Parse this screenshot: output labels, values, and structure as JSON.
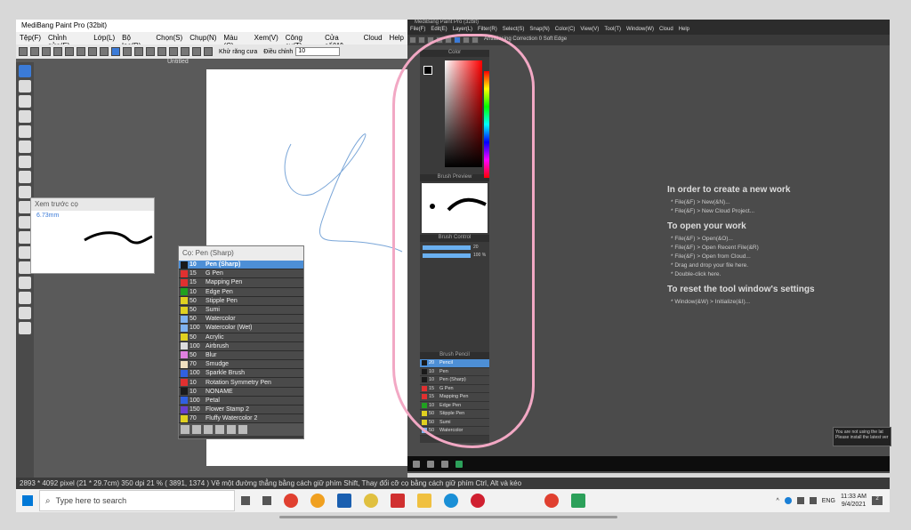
{
  "left_app": {
    "title": "MediBang Paint Pro (32bit)",
    "menu": [
      "Tệp(F)",
      "Chỉnh sửa(E)",
      "Lớp(L)",
      "Bộ lọc(R)",
      "Chọn(S)",
      "Chụp(N)",
      "Màu (C)",
      "Xem(V)",
      "Công cụ(T)",
      "Cửa số(W)",
      "Cloud",
      "Help"
    ],
    "toolbar": {
      "antialias_label": "Khử răng cưa",
      "correction_label": "Điều chỉnh",
      "correction_value": "10"
    },
    "canvas_tab": "Untitled",
    "preview": {
      "title": "Xem trước cọ",
      "size": "6.73mm"
    },
    "brush_window": {
      "title": "Cọ: Pen (Sharp)",
      "items": [
        {
          "size": "10",
          "name": "Pen (Sharp)",
          "color": "#1a1a1a"
        },
        {
          "size": "15",
          "name": "G Pen",
          "color": "#e03030"
        },
        {
          "size": "15",
          "name": "Mapping Pen",
          "color": "#e03030"
        },
        {
          "size": "10",
          "name": "Edge Pen",
          "color": "#20a020"
        },
        {
          "size": "50",
          "name": "Stipple Pen",
          "color": "#e0d020"
        },
        {
          "size": "50",
          "name": "Sumi",
          "color": "#e0d020"
        },
        {
          "size": "50",
          "name": "Watercolor",
          "color": "#7fb2f0"
        },
        {
          "size": "100",
          "name": "Watercolor (Wet)",
          "color": "#7fb2f0"
        },
        {
          "size": "50",
          "name": "Acrylic",
          "color": "#e0d020"
        },
        {
          "size": "100",
          "name": "Airbrush",
          "color": "#dddddd"
        },
        {
          "size": "50",
          "name": "Blur",
          "color": "#e080e0"
        },
        {
          "size": "70",
          "name": "Smudge",
          "color": "#f0e0c0"
        },
        {
          "size": "100",
          "name": "Sparkle Brush",
          "color": "#3060e0"
        },
        {
          "size": "10",
          "name": "Rotation Symmetry Pen",
          "color": "#e03030"
        },
        {
          "size": "10",
          "name": "NONAME",
          "color": "#1a1a1a"
        },
        {
          "size": "100",
          "name": "Petal",
          "color": "#3060e0"
        },
        {
          "size": "150",
          "name": "Flower Stamp 2",
          "color": "#6a3fd0"
        },
        {
          "size": "70",
          "name": "Fluffy Watercolor 2",
          "color": "#e0d020"
        }
      ]
    },
    "status": "2893 * 4092 pixel  (21 * 29.7cm)  350 dpi  21 %  ( 3891, 1374 )  Vẽ một đường thẳng bằng cách giữ phím Shift, Thay đổi cỡ cọ bằng cách giữ phím Ctrl, Alt và kéo"
  },
  "right_app": {
    "title": "MediBang Paint Pro (32bit)",
    "menu": [
      "File(F)",
      "Edit(E)",
      "Layer(L)",
      "Filter(R)",
      "Select(S)",
      "Snap(N)",
      "Color(C)",
      "View(V)",
      "Tool(T)",
      "Window(W)",
      "Cloud",
      "Help"
    ],
    "toolbar_text": "Antialiasing   Correction  0           Soft Edge",
    "panels": {
      "color": "Color",
      "brush_preview": "Brush Preview",
      "brush_control": "Brush Control",
      "brush_list": "Brush Pencil"
    },
    "brush_control": {
      "size": "20",
      "opacity": "100 %"
    },
    "brushes": [
      {
        "size": "20",
        "name": "Pencil",
        "color": "#1a1a1a"
      },
      {
        "size": "10",
        "name": "Pen",
        "color": "#1a1a1a"
      },
      {
        "size": "10",
        "name": "Pen (Sharp)",
        "color": "#1a1a1a"
      },
      {
        "size": "15",
        "name": "G Pen",
        "color": "#e03030"
      },
      {
        "size": "15",
        "name": "Mapping Pen",
        "color": "#e03030"
      },
      {
        "size": "10",
        "name": "Edge Pen",
        "color": "#20a020"
      },
      {
        "size": "50",
        "name": "Stipple Pen",
        "color": "#e0d020"
      },
      {
        "size": "50",
        "name": "Sumi",
        "color": "#e0d020"
      },
      {
        "size": "50",
        "name": "Watercolor",
        "color": "#7fb2f0"
      }
    ],
    "welcome": {
      "h1": "In order to create a new work",
      "s1": [
        "* File(&F) > New(&N)...",
        "* File(&F) > New Cloud Project..."
      ],
      "h2": "To open your work",
      "s2": [
        "* File(&F) > Open(&O)...",
        "* File(&F) > Open Recent File(&R)",
        "* File(&F) > Open from Cloud...",
        "* Drag and drop your file here.",
        "* Double-click here."
      ],
      "h3": "To reset the tool window's settings",
      "s3": [
        "* Window(&W) > Initialize(&I)..."
      ]
    },
    "notice": "You are not using the lat Please install the latest ver"
  },
  "taskbar": {
    "search_placeholder": "Type here to search",
    "lang": "ENG",
    "time": "11:33 AM",
    "date": "9/4/2021",
    "notif_count": "2"
  }
}
